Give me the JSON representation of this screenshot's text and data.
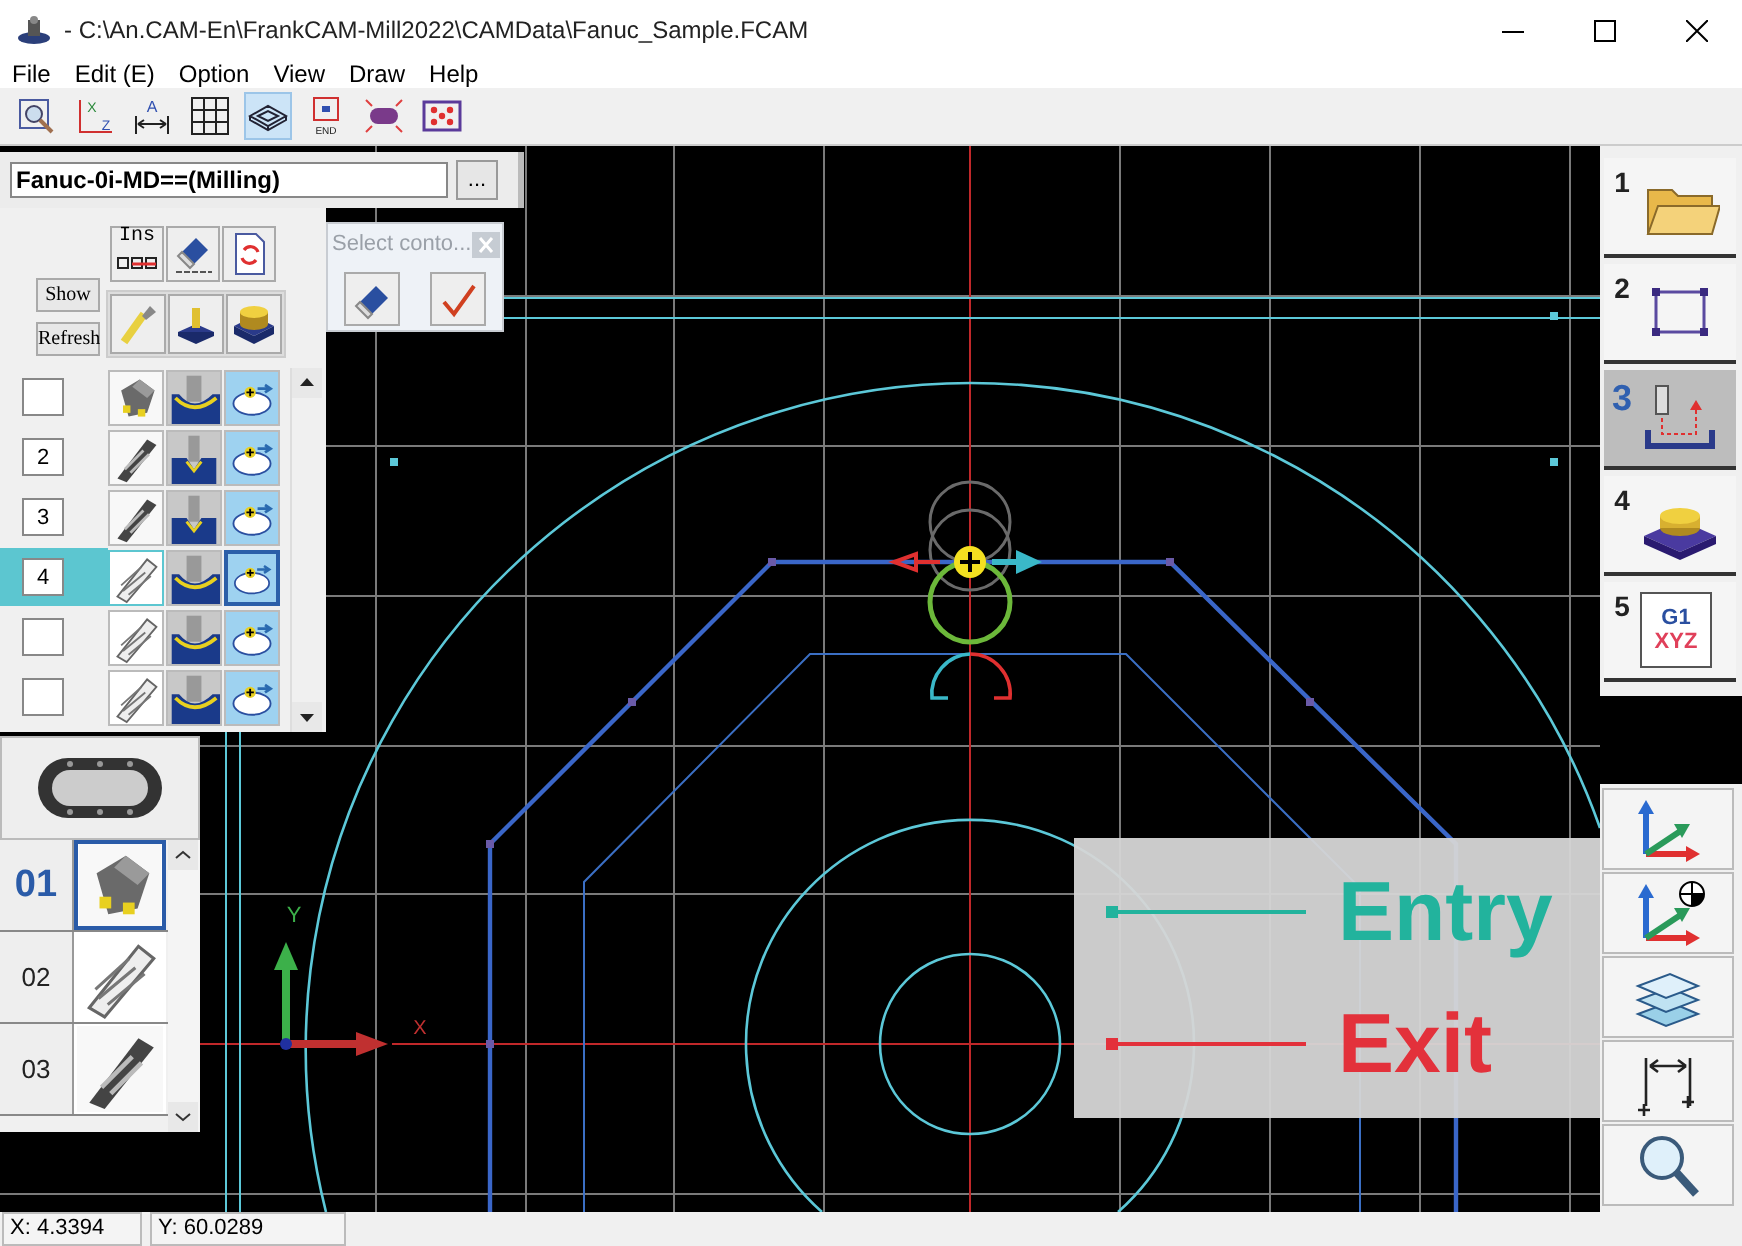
{
  "window": {
    "title": "- C:\\An.CAM-En\\FrankCAM-Mill2022\\CAMData\\Fanuc_Sample.FCAM"
  },
  "menu": [
    {
      "label": "File"
    },
    {
      "label": "Edit (E)"
    },
    {
      "label": "Option"
    },
    {
      "label": "View"
    },
    {
      "label": "Draw"
    },
    {
      "label": "Help"
    }
  ],
  "toolbar": [
    {
      "pressed": false
    },
    {
      "pressed": false,
      "labels": [
        "X",
        "Z"
      ]
    },
    {
      "pressed": false,
      "labels": [
        "A"
      ]
    },
    {
      "pressed": false
    },
    {
      "pressed": true
    },
    {
      "pressed": false,
      "labels": [
        "END"
      ]
    },
    {
      "pressed": false
    },
    {
      "pressed": false
    }
  ],
  "machine": {
    "value": "Fanuc-0i-MD==(Milling)",
    "browse_label": "..."
  },
  "operations": {
    "insert_label": "Ins",
    "show_label": "Show",
    "refresh_label": "Refresh",
    "rows": [
      {
        "kind": "face-mill",
        "selected": false
      },
      {
        "kind": "drill",
        "number": "2",
        "selected": false
      },
      {
        "kind": "drill",
        "number": "3",
        "selected": false
      },
      {
        "kind": "end-mill",
        "number": "4",
        "selected": true
      },
      {
        "kind": "end-mill",
        "selected": false
      },
      {
        "kind": "end-mill",
        "selected": false
      }
    ]
  },
  "select_dialog": {
    "title": "Select conto..."
  },
  "tools": {
    "rows": [
      {
        "kind": "face-mill",
        "number": "01",
        "selected": true
      },
      {
        "kind": "end-mill",
        "number": "02",
        "selected": false
      },
      {
        "kind": "drill",
        "number": "03",
        "selected": false
      }
    ]
  },
  "steps": [
    {
      "number": "1",
      "selected": false
    },
    {
      "number": "2",
      "selected": false
    },
    {
      "number": "3",
      "selected": true
    },
    {
      "number": "4",
      "selected": false
    },
    {
      "number": "5",
      "selected": false,
      "icon_text": [
        "G1",
        "XYZ"
      ]
    }
  ],
  "viewport": {
    "x_axis_label": "X",
    "y_axis_label": "Y",
    "legend": [
      {
        "label": "Entry",
        "color": "#22b39d"
      },
      {
        "label": "Exit",
        "color": "#e3313b"
      }
    ]
  },
  "status_bar": {
    "x": "X: 4.3394",
    "y": "Y: 60.0289"
  }
}
